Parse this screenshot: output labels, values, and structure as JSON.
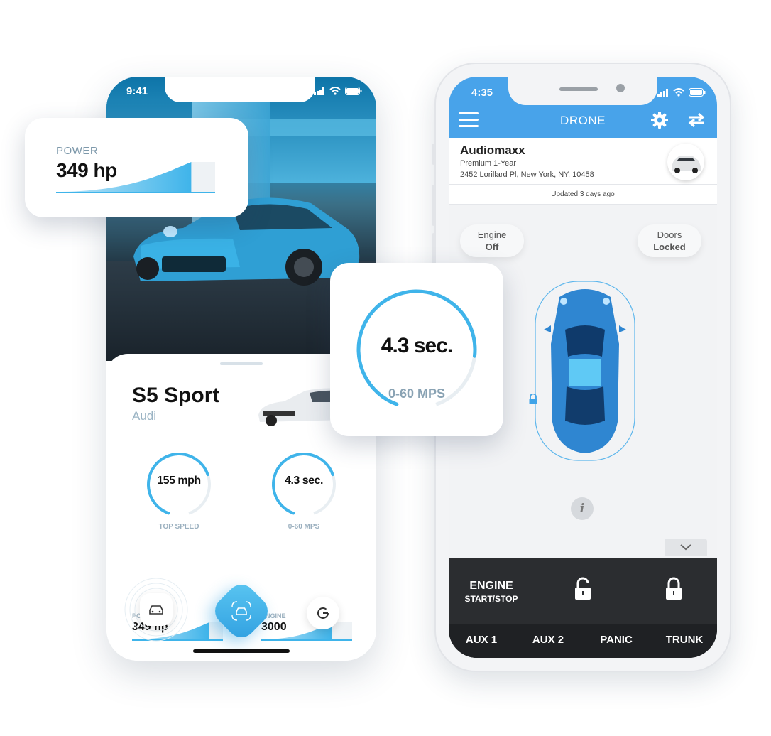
{
  "left_phone": {
    "status_time": "9:41",
    "car": {
      "model": "S5 Sport",
      "brand": "Audi"
    },
    "gauges": [
      {
        "value": "155 mph",
        "label": "TOP SPEED",
        "fraction": 0.72
      },
      {
        "value": "4.3 sec.",
        "label": "0-60 MPS",
        "fraction": 0.72
      }
    ],
    "meters": [
      {
        "label": "POWER",
        "value": "349 hp",
        "fraction": 0.85
      },
      {
        "label": "ENGINE",
        "value": "3000",
        "fraction": 0.78
      }
    ],
    "nav": {
      "car_icon": "car-icon",
      "center_icon": "car-scan-icon",
      "google_icon": "google-icon"
    }
  },
  "power_card": {
    "label": "POWER",
    "value": "349 hp",
    "fraction": 0.85
  },
  "accel_card": {
    "value": "4.3 sec.",
    "label": "0-60 MPS",
    "fraction": 0.8
  },
  "right_phone": {
    "status_time": "4:35",
    "header_title": "DRONE",
    "account": {
      "name": "Audiomaxx",
      "plan": "Premium 1-Year",
      "address": "2452 Lorillard Pl, New York, NY, 10458"
    },
    "updated": "Updated 3 days ago",
    "engine_status": {
      "label": "Engine",
      "value": "Off"
    },
    "doors_status": {
      "label": "Doors",
      "value": "Locked"
    },
    "info_icon": "i",
    "controls": {
      "engine_label": "ENGINE",
      "engine_sub": "START/STOP",
      "aux": [
        "AUX 1",
        "AUX 2",
        "PANIC",
        "TRUNK"
      ]
    }
  },
  "colors": {
    "accent": "#3fb4ea",
    "header_blue": "#48a3ea",
    "dark": "#2b2d30"
  }
}
